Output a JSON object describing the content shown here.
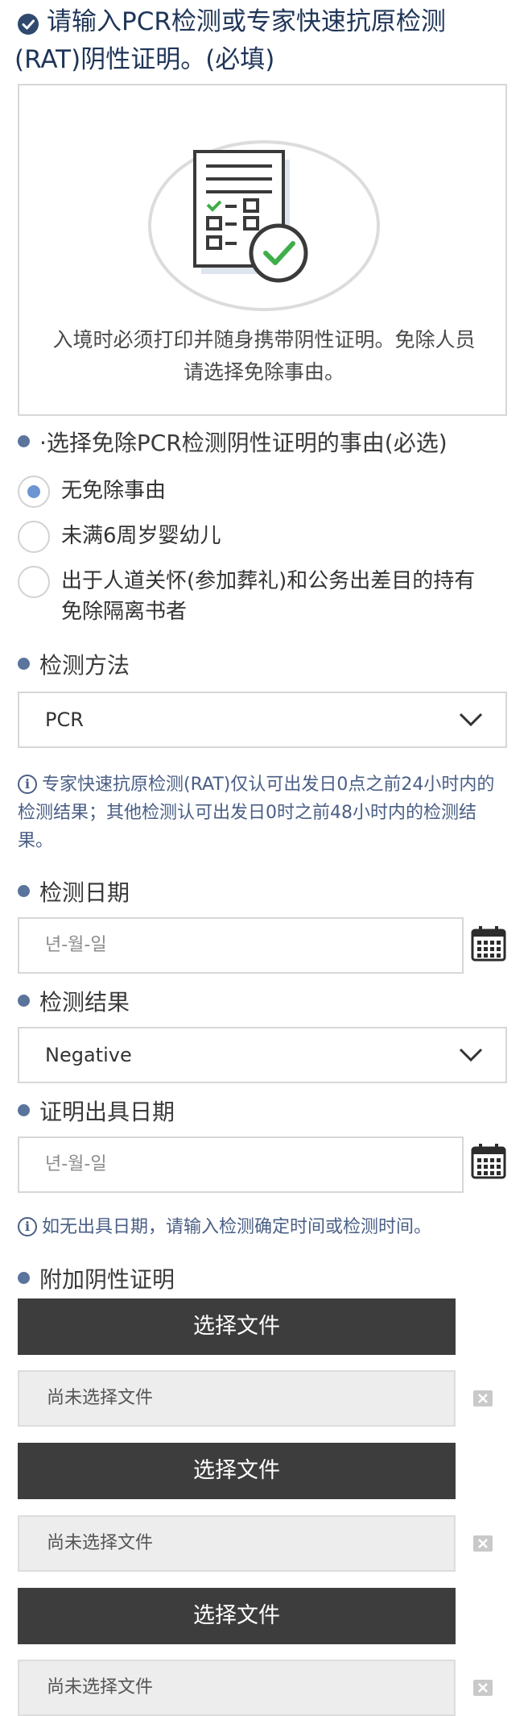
{
  "header": {
    "title_line1": "请输入PCR检测或专家快速抗原检测",
    "title_line2": "(RAT)阴性证明。(必填)"
  },
  "info_card": {
    "text": "入境时必须打印并随身携带阴性证明。免除人员请选择免除事由。",
    "icon": "negative-certificate-icon"
  },
  "exemption": {
    "label": "·选择免除PCR检测阴性证明的事由(必选)",
    "options": [
      {
        "label": "无免除事由",
        "selected": true
      },
      {
        "label": "未满6周岁婴幼儿",
        "selected": false
      },
      {
        "label": "出于人道关怀(参加葬礼)和公务出差目的持有免除隔离书者",
        "selected": false
      }
    ]
  },
  "test_method": {
    "label": "检测方法",
    "value": "PCR"
  },
  "method_note": "专家快速抗原检测(RAT)仅认可出发日0点之前24小时内的检测结果；其他检测认可出发日0时之前48小时内的检测结果。",
  "test_date": {
    "label": "检测日期",
    "placeholder": "년-월-일"
  },
  "test_result": {
    "label": "检测结果",
    "value": "Negative"
  },
  "issue_date": {
    "label": "证明出具日期",
    "placeholder": "년-월-일"
  },
  "issue_note": "如无出具日期，请输入检测确定时间或检测时间。",
  "attachments": {
    "label": "附加阴性证明",
    "files": [
      {
        "button": "选择文件",
        "status": "尚未选择文件"
      },
      {
        "button": "选择文件",
        "status": "尚未选择文件"
      },
      {
        "button": "选择文件",
        "status": "尚未选择文件"
      }
    ]
  },
  "colors": {
    "header_text": "#1f3558",
    "bullet": "#5b749c",
    "note_text": "#4a5f86",
    "radio_selected": "#6d94d3",
    "file_button_bg": "#3d3d3d",
    "check_green": "#3fae4a"
  }
}
